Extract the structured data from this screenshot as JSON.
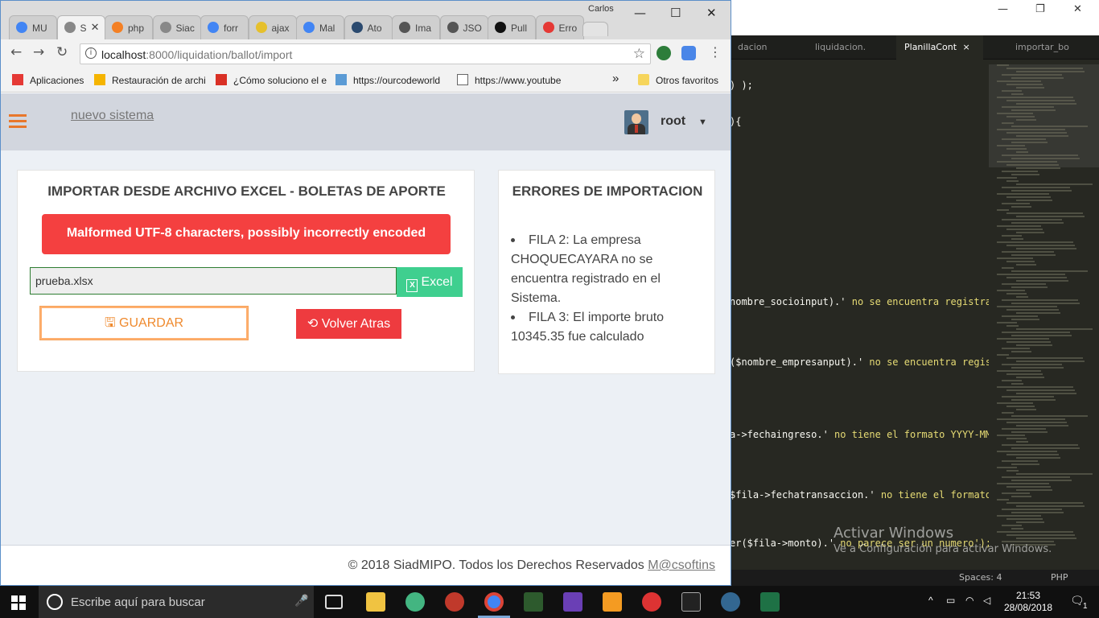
{
  "editor": {
    "tabs": [
      "dacion",
      "liquidacion.",
      "PlanillaCont",
      "importar_bo"
    ],
    "active_tab_close": "×",
    "code_fragments": {
      "l1": ") );",
      "l2": "){",
      "l3a": "nombre_socioinput).' ",
      "l3b": "no se encuentra registrad",
      "l4a": "($nombre_empresanput).' ",
      "l4b": "no se encuentra regist",
      "l5a": "a->fechaingreso.' ",
      "l5b": "no tiene el formato YYYY-MM-",
      "l6a": "$fila->fechatransaccion.' ",
      "l6b": "no tiene el formato",
      "l7a": "er($fila->monto).' ",
      "l7b": "no parece ser un numero');"
    },
    "status": {
      "spaces": "Spaces: 4",
      "syntax": "PHP"
    },
    "activate_windows": {
      "title": "Activar Windows",
      "subtitle": "Ve a Configuración para activar Windows."
    }
  },
  "chrome": {
    "profile_name": "Carlos",
    "tabs": [
      {
        "icon": "google-icon",
        "label": "MU"
      },
      {
        "icon": "page-icon",
        "label": "S",
        "active": true
      },
      {
        "icon": "stackoverflow-icon",
        "label": "php"
      },
      {
        "icon": "page-icon",
        "label": "Siac"
      },
      {
        "icon": "google-icon",
        "label": "forr"
      },
      {
        "icon": "yellow-icon",
        "label": "ajax"
      },
      {
        "icon": "google-icon",
        "label": "Mal"
      },
      {
        "icon": "atom-icon",
        "label": "Ato"
      },
      {
        "icon": "send-icon",
        "label": "Ima"
      },
      {
        "icon": "send-icon",
        "label": "JSO"
      },
      {
        "icon": "github-icon",
        "label": "Pull"
      },
      {
        "icon": "error-icon",
        "label": "Erro"
      }
    ],
    "url_host": "localhost",
    "url_path": ":8000/liquidation/ballot/import",
    "bookmarks": [
      {
        "icon": "apps-icon",
        "label": "Aplicaciones"
      },
      {
        "icon": "star-icon",
        "label": "Restauración de archi"
      },
      {
        "icon": "gmail-icon",
        "label": "¿Cómo soluciono el e"
      },
      {
        "icon": "code-icon",
        "label": "https://ourcodeworld"
      },
      {
        "icon": "page-icon",
        "label": "https://www.youtube"
      }
    ],
    "bookmarks_more": "»",
    "other_bookmarks": "Otros favoritos"
  },
  "page": {
    "brand": "nuevo sistema",
    "user": "root",
    "import_title": "IMPORTAR DESDE ARCHIVO EXCEL - BOLETAS DE APORTE",
    "alert": "Malformed UTF-8 characters, possibly incorrectly encoded",
    "file_value": "prueba.xlsx",
    "excel_label": "Excel",
    "save_label": "GUARDAR",
    "back_label": "Volver Atras",
    "errors_title": "ERRORES DE IMPORTACION",
    "errors": [
      "FILA 2: La empresa CHOQUECAYARA no se encuentra registrado en el Sistema.",
      "FILA 3: El importe bruto 10345.35 fue calculado"
    ],
    "footer_text": "© 2018 SiadMIPO. Todos los Derechos Reservados ",
    "footer_link": "M@csoftins"
  },
  "taskbar": {
    "search_placeholder": "Escribe aquí para buscar",
    "time": "21:53",
    "date": "28/08/2018",
    "notification_count": "1"
  },
  "colors": {
    "alert_red": "#f44040",
    "excel_green": "#3fcf8f",
    "save_orange": "#ef8a2e",
    "back_red": "#ee3b3f",
    "navbar": "#d2d6de",
    "page_bg": "#ecf0f5"
  }
}
